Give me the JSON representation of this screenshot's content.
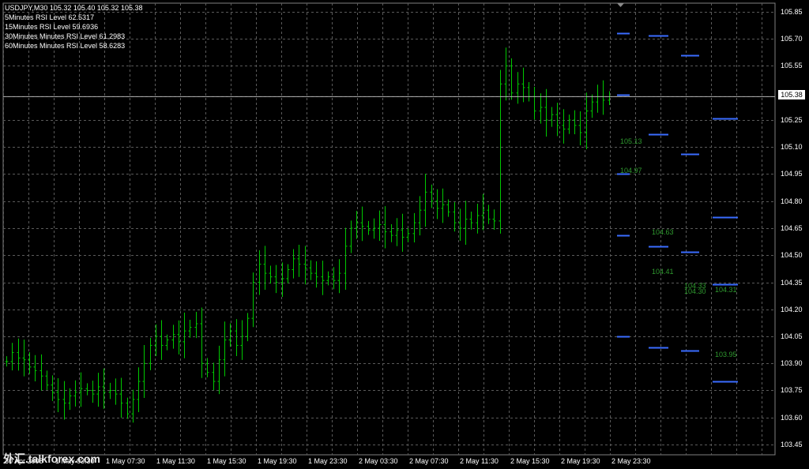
{
  "header": {
    "symbol_line": "USDJPY,M30  105.32 105.40 105.32 105.38",
    "rsi_lines": [
      "5Minutes RSI Level 62.5317",
      "15Minutes RSI Level 59.6936",
      "30Minutes Minutes RSI Level 61.2983",
      "60Minutes Minutes RSI Level 58.6283"
    ]
  },
  "current_price": "105.38",
  "watermark": "外汇.talkforex.com",
  "colors": {
    "background": "#000000",
    "grid": "#5a5a5a",
    "bars": "#00c800",
    "level_lines": "#3a6cff",
    "level_labels": "#2f9a2f",
    "price_line": "#b0b0b0"
  },
  "chart_data": {
    "type": "ohlc",
    "grid": true,
    "x_tick_labels": [
      "30 Apr 2008",
      "1 May 03:30",
      "1 May 07:30",
      "1 May 11:30",
      "1 May 15:30",
      "1 May 19:30",
      "1 May 23:30",
      "2 May 03:30",
      "2 May 07:30",
      "2 May 11:30",
      "2 May 15:30",
      "2 May 19:30",
      "2 May 23:30"
    ],
    "y_tick_labels": [
      "105.85",
      "105.70",
      "105.55",
      "105.38",
      "105.25",
      "105.10",
      "104.95",
      "104.80",
      "104.65",
      "104.50",
      "104.35",
      "104.20",
      "104.05",
      "103.90",
      "103.75",
      "103.60",
      "103.45"
    ],
    "ylim": [
      103.43,
      105.89
    ],
    "closes": [
      103.91,
      103.96,
      103.93,
      103.92,
      103.88,
      103.86,
      103.83,
      103.78,
      103.74,
      103.7,
      103.68,
      103.72,
      103.74,
      103.76,
      103.75,
      103.73,
      103.77,
      103.74,
      103.75,
      103.73,
      103.68,
      103.62,
      103.7,
      103.8,
      103.9,
      104.0,
      104.05,
      104.0,
      104.03,
      104.06,
      104.02,
      104.08,
      104.1,
      104.12,
      103.9,
      103.85,
      103.8,
      103.92,
      104.03,
      104.08,
      104.0,
      104.05,
      104.15,
      104.35,
      104.45,
      104.4,
      104.38,
      104.35,
      104.37,
      104.42,
      104.48,
      104.45,
      104.43,
      104.4,
      104.38,
      104.36,
      104.38,
      104.36,
      104.4,
      104.55,
      104.65,
      104.68,
      104.66,
      104.64,
      104.65,
      104.67,
      104.63,
      104.61,
      104.64,
      104.6,
      104.62,
      104.68,
      104.75,
      104.85,
      104.8,
      104.76,
      104.78,
      104.74,
      104.68,
      104.65,
      104.7,
      104.68,
      104.72,
      104.75,
      104.7,
      104.69,
      105.45,
      105.55,
      105.4,
      105.45,
      105.43,
      105.38,
      105.3,
      105.32,
      105.25,
      105.28,
      105.22,
      105.2,
      105.25,
      105.22,
      105.18,
      105.3,
      105.35,
      105.38,
      105.36,
      105.38
    ],
    "level_lines": [
      {
        "value": 105.73,
        "segment": 0
      },
      {
        "value": 105.39,
        "segment": 0
      },
      {
        "value": 104.95,
        "segment": 0
      },
      {
        "value": 104.61,
        "segment": 0
      },
      {
        "value": 104.05,
        "segment": 0
      },
      {
        "value": 105.72,
        "segment": 1
      },
      {
        "value": 105.17,
        "segment": 1
      },
      {
        "value": 104.55,
        "segment": 1
      },
      {
        "value": 103.99,
        "segment": 1
      },
      {
        "value": 105.61,
        "segment": 2
      },
      {
        "value": 105.06,
        "segment": 2
      },
      {
        "value": 104.52,
        "segment": 2
      },
      {
        "value": 103.97,
        "segment": 2
      },
      {
        "value": 105.26,
        "segment": 3
      },
      {
        "value": 104.71,
        "segment": 3
      },
      {
        "value": 104.34,
        "segment": 3
      },
      {
        "value": 103.8,
        "segment": 3
      }
    ],
    "level_labels": [
      {
        "text": "105.13",
        "value": 105.13,
        "segment": 0
      },
      {
        "text": "104.97",
        "value": 104.97,
        "segment": 0
      },
      {
        "text": "104.63",
        "value": 104.63,
        "segment": 1
      },
      {
        "text": "104.41",
        "value": 104.41,
        "segment": 1
      },
      {
        "text": "104.33",
        "value": 104.33,
        "segment": 2
      },
      {
        "text": "104.30",
        "value": 104.3,
        "segment": 2
      },
      {
        "text": "104.31",
        "value": 104.31,
        "segment": 3
      },
      {
        "text": "103.95",
        "value": 103.95,
        "segment": 3
      }
    ]
  }
}
